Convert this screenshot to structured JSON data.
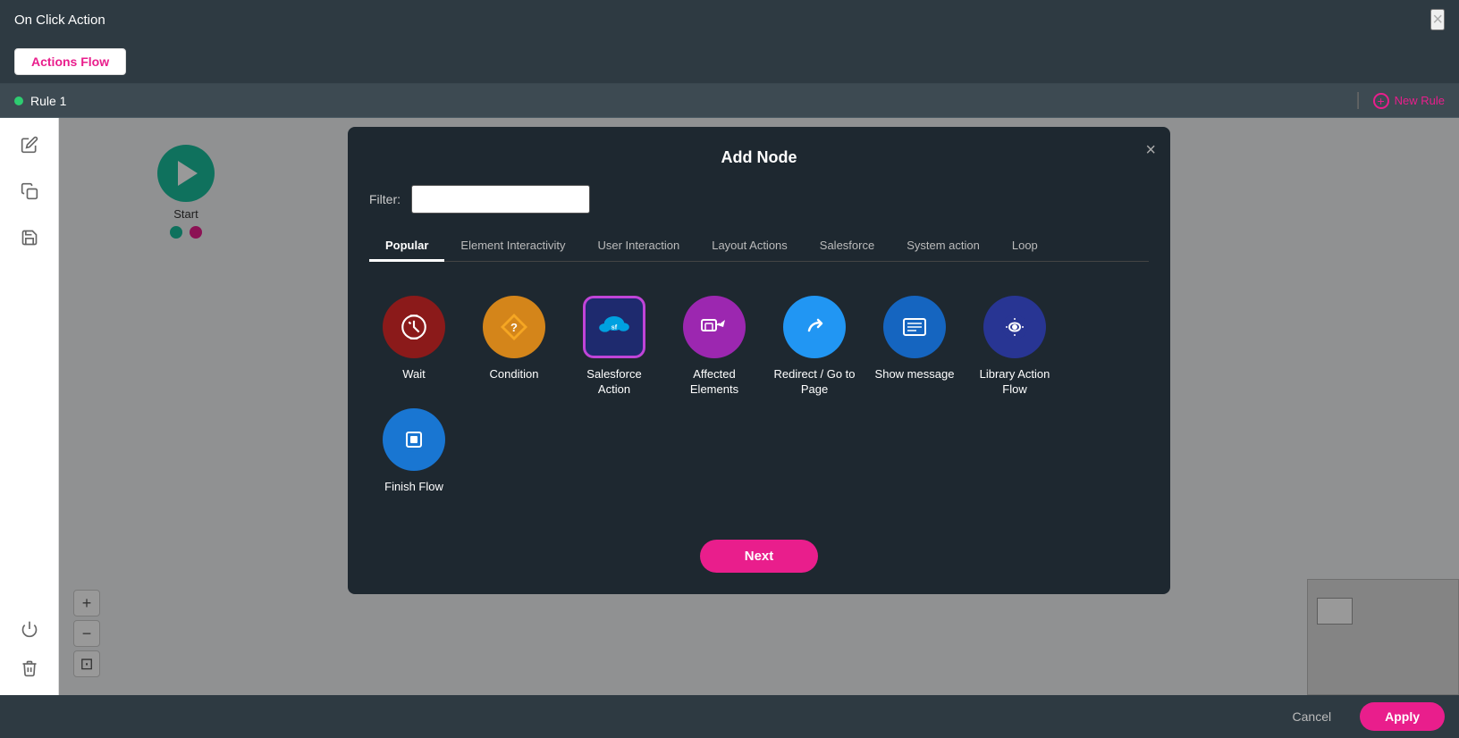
{
  "topBar": {
    "title": "On Click Action",
    "closeLabel": "×"
  },
  "tabBar": {
    "activeTab": "Actions Flow"
  },
  "ruleBar": {
    "ruleName": "Rule 1",
    "newRuleLabel": "New Rule"
  },
  "sidebar": {
    "icons": [
      "pencil",
      "copy",
      "save",
      "power",
      "trash"
    ]
  },
  "startNode": {
    "label": "Start"
  },
  "zoomControls": {
    "zoomIn": "+",
    "zoomOut": "−",
    "fit": "⊡"
  },
  "bottomBar": {
    "cancelLabel": "Cancel",
    "applyLabel": "Apply"
  },
  "modal": {
    "title": "Add Node",
    "closeLabel": "×",
    "filter": {
      "label": "Filter:",
      "placeholder": ""
    },
    "tabs": [
      {
        "id": "popular",
        "label": "Popular",
        "active": true
      },
      {
        "id": "element-interactivity",
        "label": "Element Interactivity",
        "active": false
      },
      {
        "id": "user-interaction",
        "label": "User Interaction",
        "active": false
      },
      {
        "id": "layout-actions",
        "label": "Layout Actions",
        "active": false
      },
      {
        "id": "salesforce",
        "label": "Salesforce",
        "active": false
      },
      {
        "id": "system-action",
        "label": "System action",
        "active": false
      },
      {
        "id": "loop",
        "label": "Loop",
        "active": false
      }
    ],
    "nodes": [
      {
        "id": "wait",
        "label": "Wait",
        "icon": "wait",
        "iconSymbol": "⏱"
      },
      {
        "id": "condition",
        "label": "Condition",
        "icon": "condition",
        "iconSymbol": "◇"
      },
      {
        "id": "salesforce-action",
        "label": "Salesforce Action",
        "icon": "salesforce",
        "iconSymbol": "sf"
      },
      {
        "id": "affected-elements",
        "label": "Affected Elements",
        "icon": "affected",
        "iconSymbol": "↗"
      },
      {
        "id": "redirect",
        "label": "Redirect / Go to Page",
        "icon": "redirect",
        "iconSymbol": "↪"
      },
      {
        "id": "show-message",
        "label": "Show message",
        "icon": "show-msg",
        "iconSymbol": "☰"
      },
      {
        "id": "library-action-flow",
        "label": "Library Action Flow",
        "icon": "library",
        "iconSymbol": "↻"
      },
      {
        "id": "finish-flow",
        "label": "Finish Flow",
        "icon": "finish",
        "iconSymbol": "⊡"
      }
    ],
    "nextButton": "Next"
  }
}
